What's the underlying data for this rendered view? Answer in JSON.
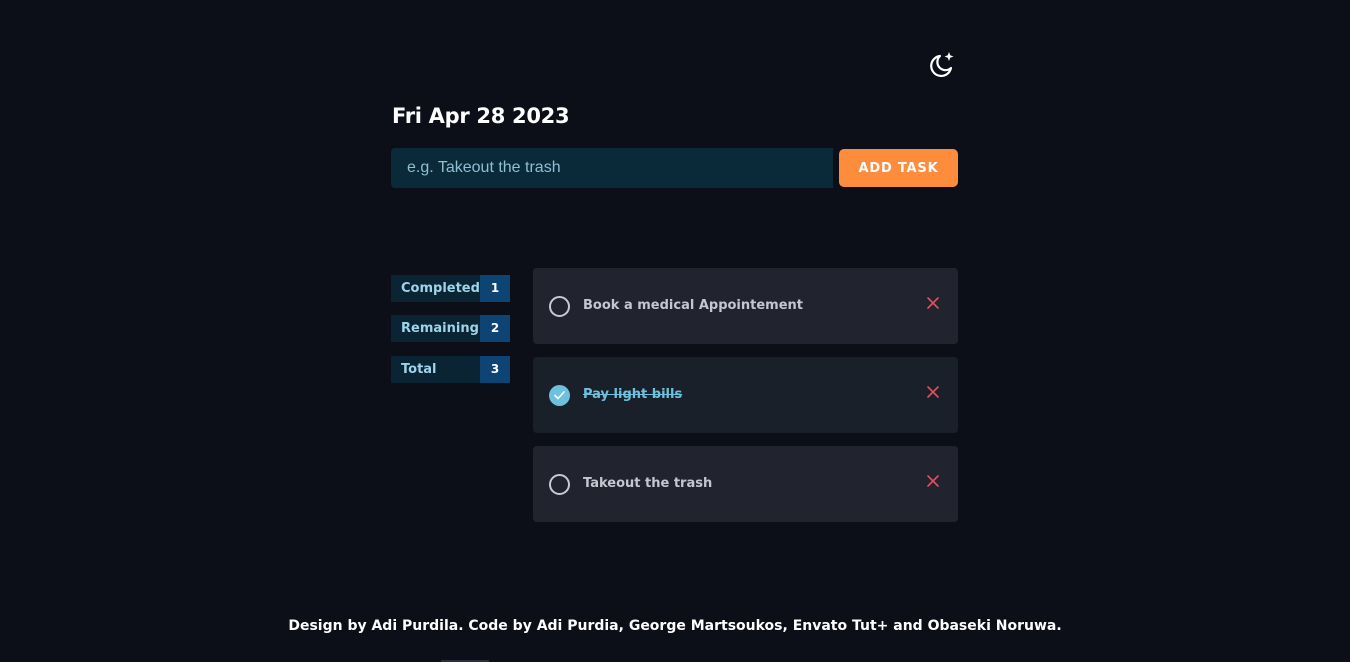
{
  "header": {
    "theme_toggle_icon": "moon-sparkle-icon",
    "date": "Fri Apr 28 2023"
  },
  "new_task": {
    "placeholder": "e.g. Takeout the trash",
    "value": "",
    "add_label": "ADD TASK"
  },
  "stats": [
    {
      "label": "Completed",
      "count": "1"
    },
    {
      "label": "Remaining",
      "count": "2"
    },
    {
      "label": "Total",
      "count": "3"
    }
  ],
  "tasks": [
    {
      "text": "Book a medical Appointement",
      "completed": false
    },
    {
      "text": "Pay light bills",
      "completed": true
    },
    {
      "text": "Takeout the trash",
      "completed": false
    }
  ],
  "footer": {
    "credits": "Design by Adi Purdila. Code by Adi Purdia, George Martsoukos, Envato Tut+ and Obaseki Noruwa."
  },
  "colors": {
    "background": "#0c0f17",
    "accent": "#fd8c3d",
    "check": "#6ec1de",
    "delete": "#e0505f"
  }
}
